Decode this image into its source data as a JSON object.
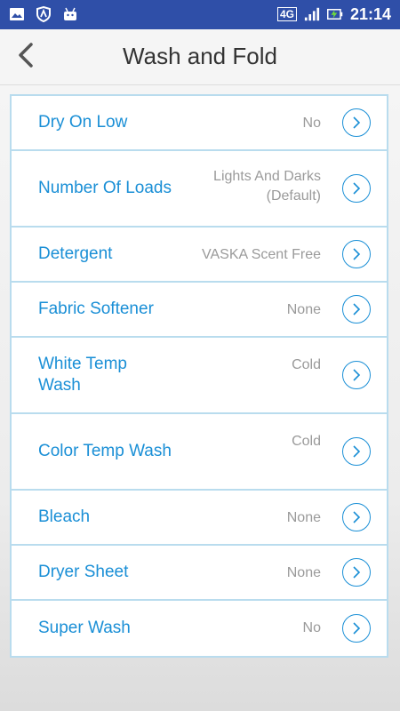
{
  "status_bar": {
    "network": "4G",
    "time": "21:14"
  },
  "header": {
    "title": "Wash and Fold"
  },
  "options": [
    {
      "label": "Dry On Low",
      "value": "No"
    },
    {
      "label": "Number Of Loads",
      "value": "Lights And Darks (Default)"
    },
    {
      "label": "Detergent",
      "value": "VASKA Scent Free"
    },
    {
      "label": "Fabric Softener",
      "value": "None"
    },
    {
      "label": "White Temp Wash",
      "value": "Cold"
    },
    {
      "label": "Color Temp Wash",
      "value": "Cold"
    },
    {
      "label": "Bleach",
      "value": "None"
    },
    {
      "label": "Dryer Sheet",
      "value": "None"
    },
    {
      "label": "Super Wash",
      "value": "No"
    }
  ],
  "colors": {
    "status_bar": "#2f4fa8",
    "accent": "#1a8fd6",
    "row_border": "#b9dcee",
    "value_text": "#9a9a9a"
  }
}
